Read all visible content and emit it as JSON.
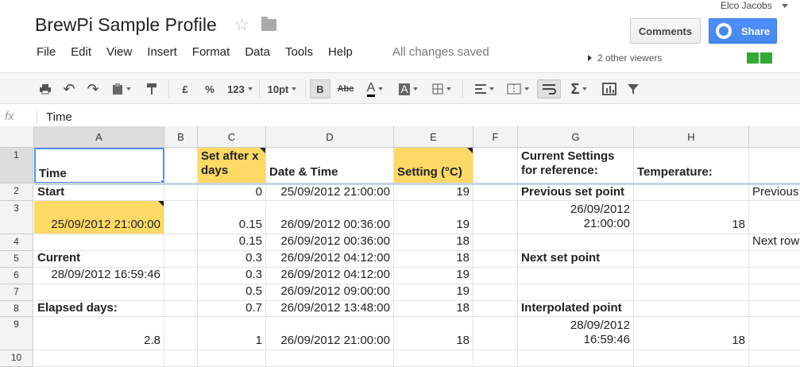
{
  "header": {
    "title": "BrewPi Sample Profile",
    "user": "Elco Jacobs",
    "comments_label": "Comments",
    "share_label": "Share",
    "save_status": "All changes saved",
    "viewers": "2 other viewers",
    "viewer_color": "#33aa33"
  },
  "menu": [
    "File",
    "Edit",
    "View",
    "Insert",
    "Format",
    "Data",
    "Tools",
    "Help"
  ],
  "toolbar": {
    "currency": "£",
    "percent": "%",
    "number_format": "123",
    "font_size": "10pt",
    "bold": "B",
    "strike": "Abc",
    "text_color": "A",
    "fill_color": "A",
    "sum": "Σ"
  },
  "formula_bar": {
    "fx": "fx",
    "value": "Time"
  },
  "columns": [
    "A",
    "B",
    "C",
    "D",
    "E",
    "F",
    "G",
    "H"
  ],
  "rows": [
    "1",
    "2",
    "3",
    "4",
    "5",
    "6",
    "7",
    "8",
    "9",
    "10"
  ],
  "cells": {
    "A1": "Time",
    "C1a": "Set after x",
    "C1b": "days",
    "D1": "Date & Time",
    "E1": "Setting (°C)",
    "G1a": "Current Settings",
    "G1b": "for reference:",
    "H1": "Temperature:",
    "A2": "Start",
    "C2": "0",
    "D2": "25/09/2012 21:00:00",
    "E2": "19",
    "G2": "Previous set point",
    "I2": "Previous",
    "A3": "25/09/2012 21:00:00",
    "C3": "0.15",
    "D3": "26/09/2012 00:36:00",
    "E3": "19",
    "G3a": "26/09/2012",
    "G3b": "21:00:00",
    "H3": "18",
    "C4": "0.15",
    "D4": "26/09/2012 00:36:00",
    "E4": "18",
    "I4": "Next row",
    "A5": "Current",
    "C5": "0.3",
    "D5": "26/09/2012 04:12:00",
    "E5": "18",
    "G5": "Next set point",
    "A6": "28/09/2012 16:59:46",
    "C6": "0.3",
    "D6": "26/09/2012 04:12:00",
    "E6": "19",
    "C7": "0.5",
    "D7": "26/09/2012 09:00:00",
    "E7": "19",
    "A8": "Elapsed days:",
    "C8": "0.7",
    "D8": "26/09/2012 13:48:00",
    "E8": "18",
    "G8": "Interpolated point",
    "A9": "2.8",
    "C9": "1",
    "D9": "26/09/2012 21:00:00",
    "E9": "18",
    "G9a": "28/09/2012",
    "G9b": "16:59:46",
    "H9": "18"
  },
  "highlight_color": "#ffd966"
}
